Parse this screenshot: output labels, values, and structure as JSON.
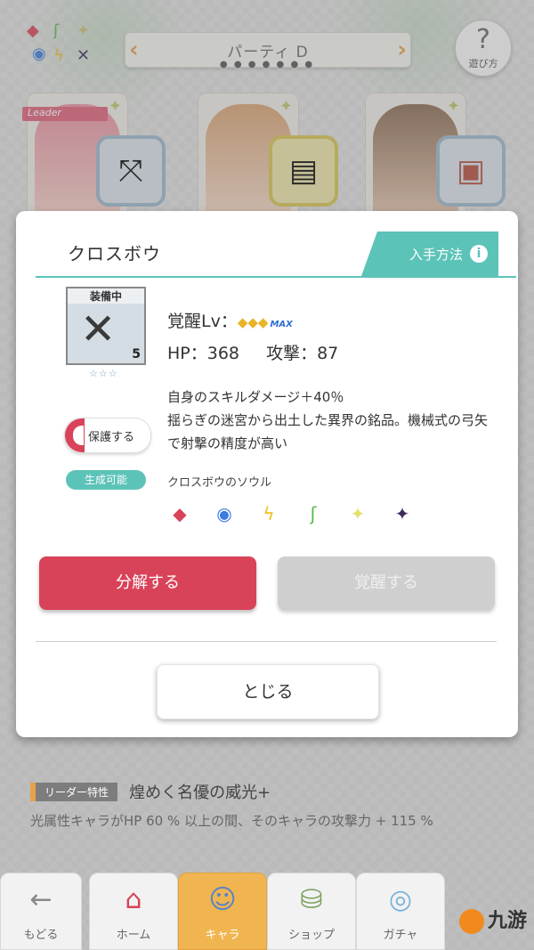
{
  "header": {
    "party_title": "パーティ D",
    "page_dots": "● ● ● ● ● ● ●",
    "help_icon": "?",
    "help_label": "遊び方"
  },
  "attributes_cluster": [
    "◆",
    "◉",
    "ϟ",
    "ʃ",
    "✦",
    "✕"
  ],
  "characters": [
    {
      "leader_tag": "Leader",
      "weapon_icon": "crossbow-icon",
      "weapon_glyph": "⤧"
    },
    {
      "weapon_icon": "book-icon",
      "weapon_glyph": "▤"
    },
    {
      "weapon_icon": "tome-icon",
      "weapon_glyph": "▣"
    }
  ],
  "dialog": {
    "title": "クロスボウ",
    "acquire_label": "入手方法",
    "acquire_info": "i",
    "equipped_label": "装備中",
    "item_count": "5",
    "rarity": "☆☆☆",
    "protect_label": "保護する",
    "awaken_label": "覚醒Lv：",
    "awaken_stars": "◆◆◆",
    "awaken_max": "MAX",
    "hp_label": "HP：368",
    "atk_label": "攻撃：87",
    "description_line1": "自身のスキルダメージ＋40％",
    "description_line2": "揺らぎの迷宮から出土した異界の銘品。機械式の弓矢で射撃の精度が高い",
    "gen_badge": "生成可能",
    "soul_name": "クロスボウのソウル",
    "elements": [
      {
        "name": "fire-element-icon",
        "glyph": "◆",
        "color": "#d9435a"
      },
      {
        "name": "water-element-icon",
        "glyph": "◉",
        "color": "#3a7be0"
      },
      {
        "name": "thunder-element-icon",
        "glyph": "ϟ",
        "color": "#f0c020"
      },
      {
        "name": "wind-element-icon",
        "glyph": "ʃ",
        "color": "#55b84a"
      },
      {
        "name": "light-element-icon",
        "glyph": "✦",
        "color": "#e4e070"
      },
      {
        "name": "dark-element-icon",
        "glyph": "✦",
        "color": "#3b2a5a"
      }
    ],
    "decompose_label": "分解する",
    "awaken_button_label": "覚醒する",
    "close_label": "とじる"
  },
  "leader_skill": {
    "chip": "リーダー特性",
    "name": "煌めく名優の威光+",
    "description": "光属性キャラがHP 60 % 以上の間、そのキャラの攻撃力 + 115 %"
  },
  "nav": [
    {
      "name": "nav-back",
      "icon": "←",
      "label": "もどる"
    },
    {
      "name": "nav-home",
      "icon": "⌂",
      "label": "ホーム"
    },
    {
      "name": "nav-chara",
      "icon": "☺",
      "label": "キャラ",
      "active": true
    },
    {
      "name": "nav-shop",
      "icon": "⛁",
      "label": "ショップ"
    },
    {
      "name": "nav-gacha",
      "icon": "◎",
      "label": "ガチャ"
    }
  ],
  "watermark": "九游",
  "colors": {
    "accent_teal": "#5cc3b8",
    "decompose_red": "#d9435a",
    "nav_active": "#f0b550"
  }
}
